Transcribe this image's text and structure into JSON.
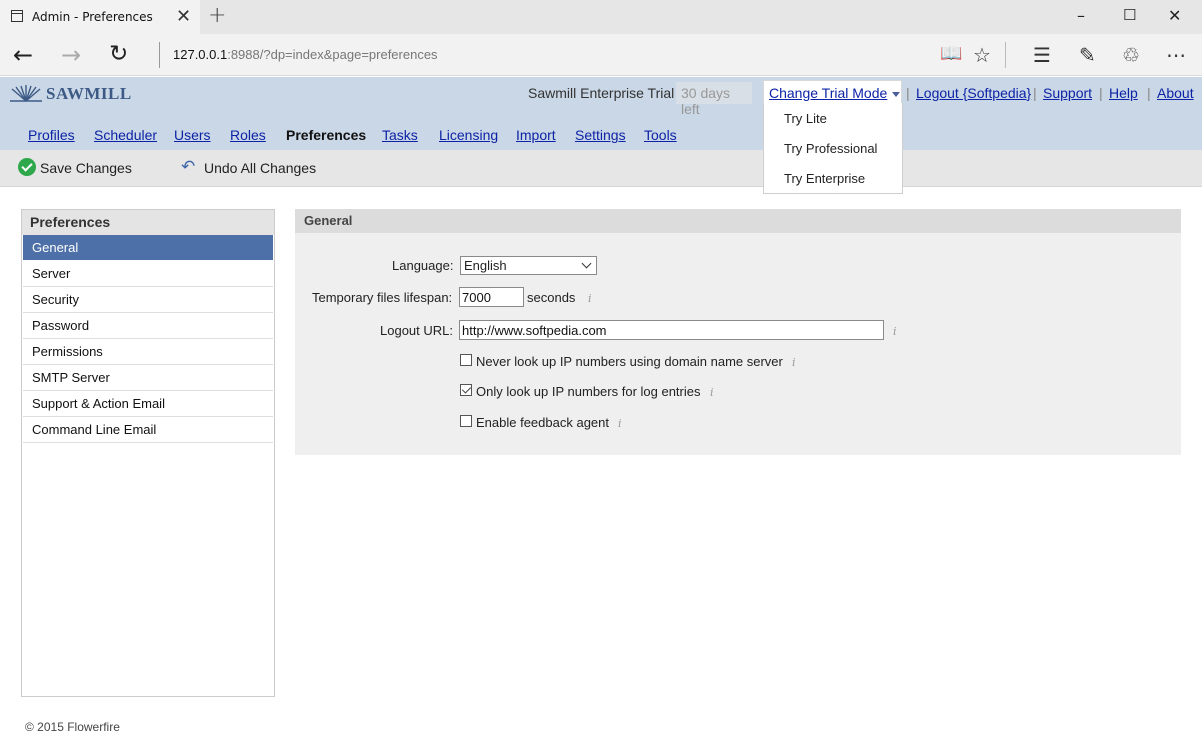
{
  "browser": {
    "tab_title": "Admin - Preferences",
    "url_host": "127.0.0.1",
    "url_rest": ":8988/?dp=index&page=preferences"
  },
  "header": {
    "logo": "SAWMILL",
    "trial_text": "Sawmill Enterprise Trial",
    "days_left": "30 days left",
    "change_trial": "Change Trial Mode",
    "links": [
      "Logout {Softpedia}",
      "Support",
      "Help",
      "About"
    ]
  },
  "nav": [
    "Profiles",
    "Scheduler",
    "Users",
    "Roles",
    "Preferences",
    "Tasks",
    "Licensing",
    "Import",
    "Settings",
    "Tools"
  ],
  "dropdown": [
    "Try Lite",
    "Try Professional",
    "Try Enterprise"
  ],
  "toolbar": {
    "save_label": "Save Changes",
    "undo_label": "Undo All Changes"
  },
  "sidebar": {
    "title": "Preferences",
    "items": [
      "General",
      "Server",
      "Security",
      "Password",
      "Permissions",
      "SMTP Server",
      "Support & Action Email",
      "Command Line Email"
    ]
  },
  "panel": {
    "title": "General",
    "language_label": "Language:",
    "language_value": "English",
    "temp_label": "Temporary files lifespan:",
    "temp_value": "7000",
    "temp_unit": "seconds",
    "logout_label": "Logout URL:",
    "logout_value": "http://www.softpedia.com",
    "cb1_label": "Never look up IP numbers using domain name server",
    "cb1_checked": false,
    "cb2_label": "Only look up IP numbers for log entries",
    "cb2_checked": true,
    "cb3_label": "Enable feedback agent",
    "cb3_checked": false
  },
  "footer": "© 2015 Flowerfire"
}
